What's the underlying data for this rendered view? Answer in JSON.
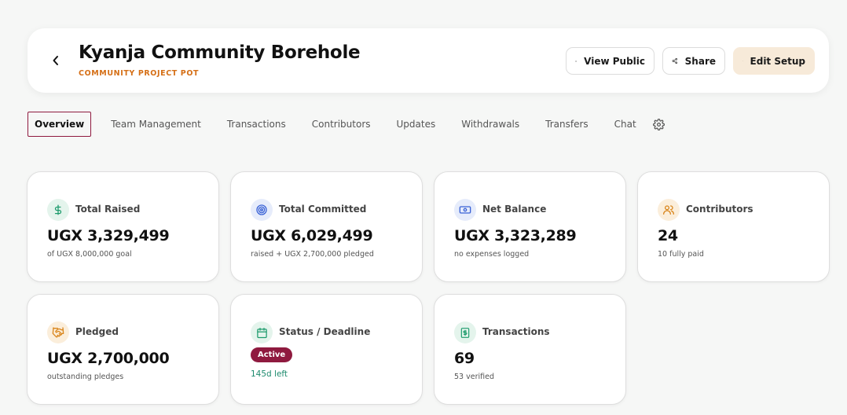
{
  "header": {
    "title": "Kyanja Community Borehole",
    "subtitle": "COMMUNITY PROJECT POT",
    "buttons": {
      "view_public": "View Public",
      "share": "Share",
      "edit_setup": "Edit Setup"
    }
  },
  "tabs": [
    {
      "label": "Overview",
      "active": true
    },
    {
      "label": "Team Management"
    },
    {
      "label": "Transactions"
    },
    {
      "label": "Contributors"
    },
    {
      "label": "Updates"
    },
    {
      "label": "Withdrawals"
    },
    {
      "label": "Transfers"
    },
    {
      "label": "Chat"
    }
  ],
  "cards": {
    "total_raised": {
      "label": "Total Raised",
      "value": "UGX 3,329,499",
      "note": "of UGX 8,000,000 goal",
      "icon": "dollar-icon",
      "color": "#1d9b6c"
    },
    "total_committed": {
      "label": "Total Committed",
      "value": "UGX 6,029,499",
      "note": "raised + UGX 2,700,000 pledged",
      "icon": "target-icon",
      "color": "#3b63d6"
    },
    "net_balance": {
      "label": "Net Balance",
      "value": "UGX 3,323,289",
      "note": "no expenses logged",
      "icon": "banknote-icon",
      "color": "#3b63d6"
    },
    "contributors": {
      "label": "Contributors",
      "value": "24",
      "note": "10 fully paid",
      "icon": "users-icon",
      "color": "#d9851b"
    },
    "pledged": {
      "label": "Pledged",
      "value": "UGX 2,700,000",
      "note": "outstanding pledges",
      "icon": "handshake-icon",
      "color": "#d9851b"
    },
    "status": {
      "label": "Status / Deadline",
      "badge": "Active",
      "note": "145d left",
      "icon": "calendar-icon",
      "color": "#1d9b6c"
    },
    "transactions": {
      "label": "Transactions",
      "value": "69",
      "note": "53 verified",
      "icon": "receipt-icon",
      "color": "#1d9b6c"
    }
  }
}
